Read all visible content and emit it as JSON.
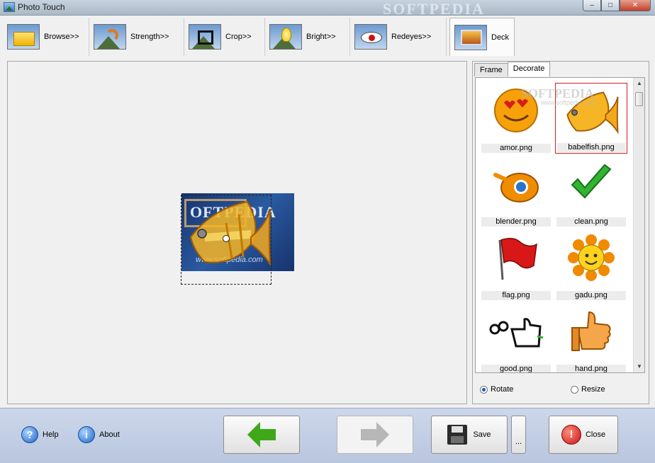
{
  "window": {
    "title": "Photo Touch",
    "watermark": "SOFTPEDIA",
    "minimize_glyph": "–",
    "maximize_glyph": "□",
    "close_glyph": "✕"
  },
  "toolbar": {
    "tools": [
      {
        "label": "Browse>>",
        "icon": "folder-icon"
      },
      {
        "label": "Strength>>",
        "icon": "strength-icon"
      },
      {
        "label": "Crop>>",
        "icon": "crop-icon"
      },
      {
        "label": "Bright>>",
        "icon": "bulb-icon"
      },
      {
        "label": "Redeyes>>",
        "icon": "eye-icon"
      },
      {
        "label": "Deck",
        "icon": "deck-icon"
      }
    ],
    "selected": "Deck"
  },
  "canvas": {
    "photo_text": "OFTPEDIA",
    "photo_url": "www.softpedia.com"
  },
  "sidepanel": {
    "tabs": [
      "Frame",
      "Decorate"
    ],
    "active_tab": "Decorate",
    "gallery_watermark": "SOFTPEDIA",
    "gallery_url": "www.softpedia.com",
    "items": [
      {
        "caption": "amor.png"
      },
      {
        "caption": "babelfish.png",
        "selected": true
      },
      {
        "caption": "blender.png"
      },
      {
        "caption": "clean.png"
      },
      {
        "caption": "flag.png"
      },
      {
        "caption": "gadu.png"
      },
      {
        "caption": "good.png"
      },
      {
        "caption": "hand.png"
      }
    ],
    "scroll_up_glyph": "▲",
    "scroll_down_glyph": "▼",
    "radio": {
      "rotate_label": "Rotate",
      "resize_label": "Resize",
      "selected": "Rotate"
    }
  },
  "bottom": {
    "help_label": "Help",
    "about_label": "About",
    "help_glyph": "?",
    "about_glyph": "i",
    "save_label": "Save",
    "more_label": "...",
    "close_label": "Close",
    "close_glyph": "!"
  },
  "colors": {
    "accent_green": "#3fa71a",
    "selection_red": "#d02020",
    "disabled_gray": "#b7b7b7"
  }
}
